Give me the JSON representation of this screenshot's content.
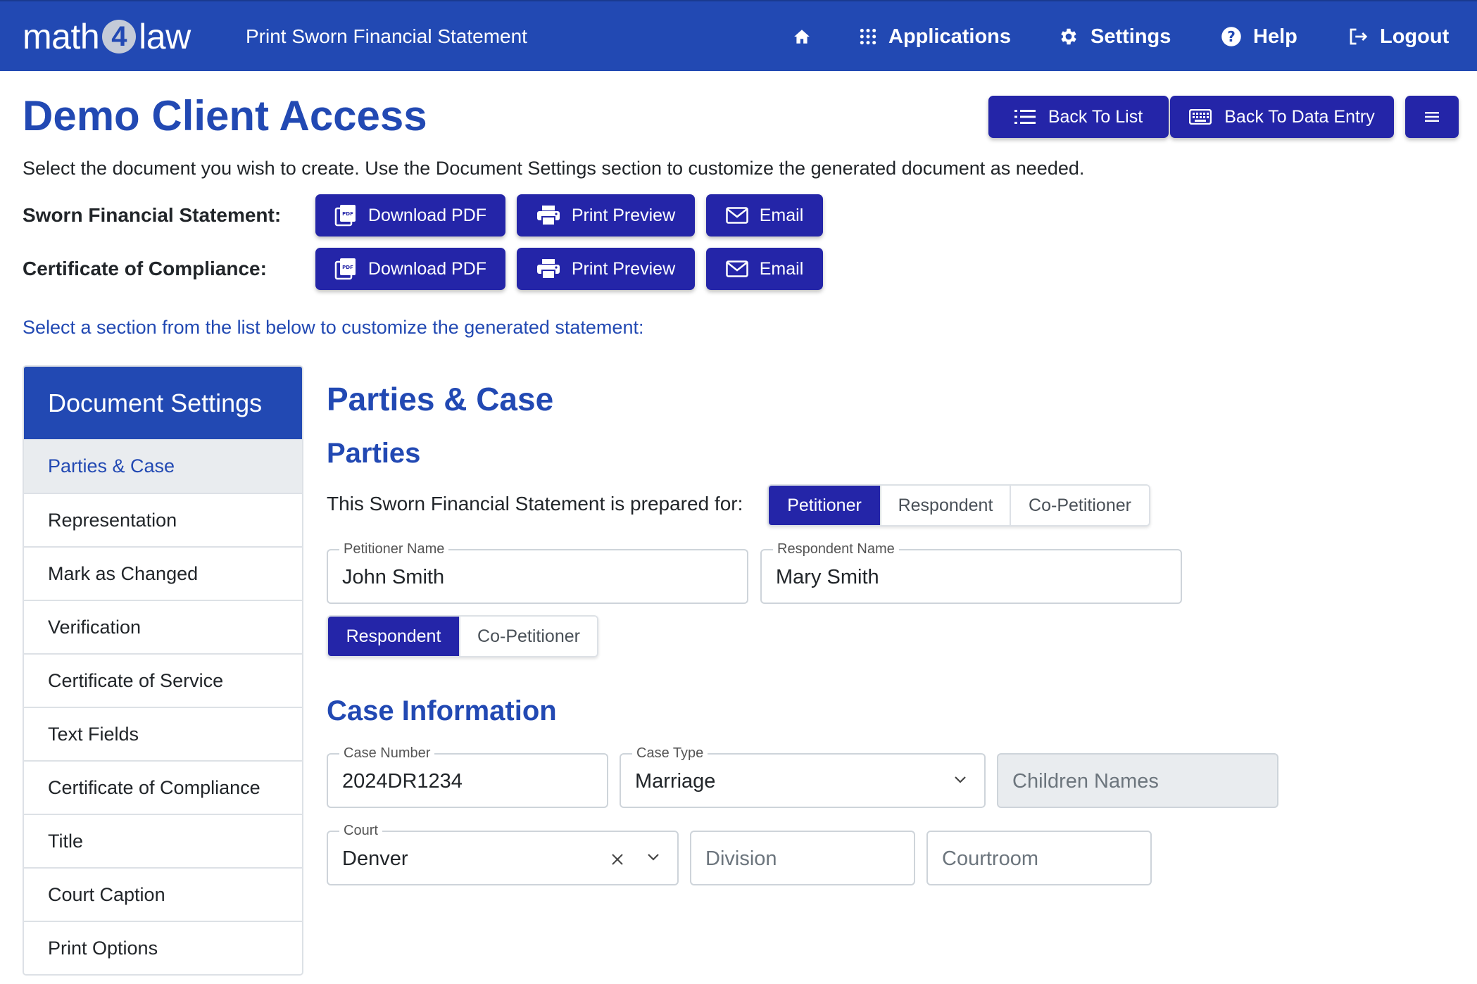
{
  "nav": {
    "logo_left": "math",
    "logo_mid": "4",
    "logo_right": "law",
    "title": "Print Sworn Financial Statement",
    "items": [
      {
        "label": "Applications",
        "icon": "grid-icon"
      },
      {
        "label": "Settings",
        "icon": "gear-icon"
      },
      {
        "label": "Help",
        "icon": "help-icon"
      },
      {
        "label": "Logout",
        "icon": "logout-icon"
      }
    ],
    "home_icon": "home-icon"
  },
  "header": {
    "title": "Demo Client Access",
    "back_to_list": "Back To List",
    "back_to_data_entry": "Back To Data Entry",
    "menu_icon": "hamburger-icon"
  },
  "intro": "Select the document you wish to create. Use the Document Settings section to customize the generated document as needed.",
  "documents": [
    {
      "label": "Sworn Financial Statement:",
      "download": "Download PDF",
      "preview": "Print Preview",
      "email": "Email"
    },
    {
      "label": "Certificate of Compliance:",
      "download": "Download PDF",
      "preview": "Print Preview",
      "email": "Email"
    }
  ],
  "hint": "Select a section from the list below to customize the generated statement:",
  "sidebar": {
    "title": "Document Settings",
    "items": [
      {
        "label": "Parties & Case",
        "active": true
      },
      {
        "label": "Representation"
      },
      {
        "label": "Mark as Changed"
      },
      {
        "label": "Verification"
      },
      {
        "label": "Certificate of Service"
      },
      {
        "label": "Text Fields"
      },
      {
        "label": "Certificate of Compliance"
      },
      {
        "label": "Title"
      },
      {
        "label": "Court Caption"
      },
      {
        "label": "Print Options"
      }
    ]
  },
  "main": {
    "section_title": "Parties & Case",
    "parties_title": "Parties",
    "prepared_for_label": "This Sworn Financial Statement is prepared for:",
    "prepared_for_options": [
      "Petitioner",
      "Respondent",
      "Co-Petitioner"
    ],
    "prepared_for_selected": "Petitioner",
    "petitioner_name_label": "Petitioner Name",
    "petitioner_name_value": "John Smith",
    "respondent_name_label": "Respondent Name",
    "respondent_name_value": "Mary Smith",
    "other_party_options": [
      "Respondent",
      "Co-Petitioner"
    ],
    "other_party_selected": "Respondent",
    "case_info_title": "Case Information",
    "case_number_label": "Case Number",
    "case_number_value": "2024DR1234",
    "case_type_label": "Case Type",
    "case_type_value": "Marriage",
    "children_names_placeholder": "Children Names",
    "court_label": "Court",
    "court_value": "Denver",
    "division_placeholder": "Division",
    "courtroom_placeholder": "Courtroom"
  },
  "colors": {
    "brand": "#2249b3",
    "button": "#2425a8"
  }
}
